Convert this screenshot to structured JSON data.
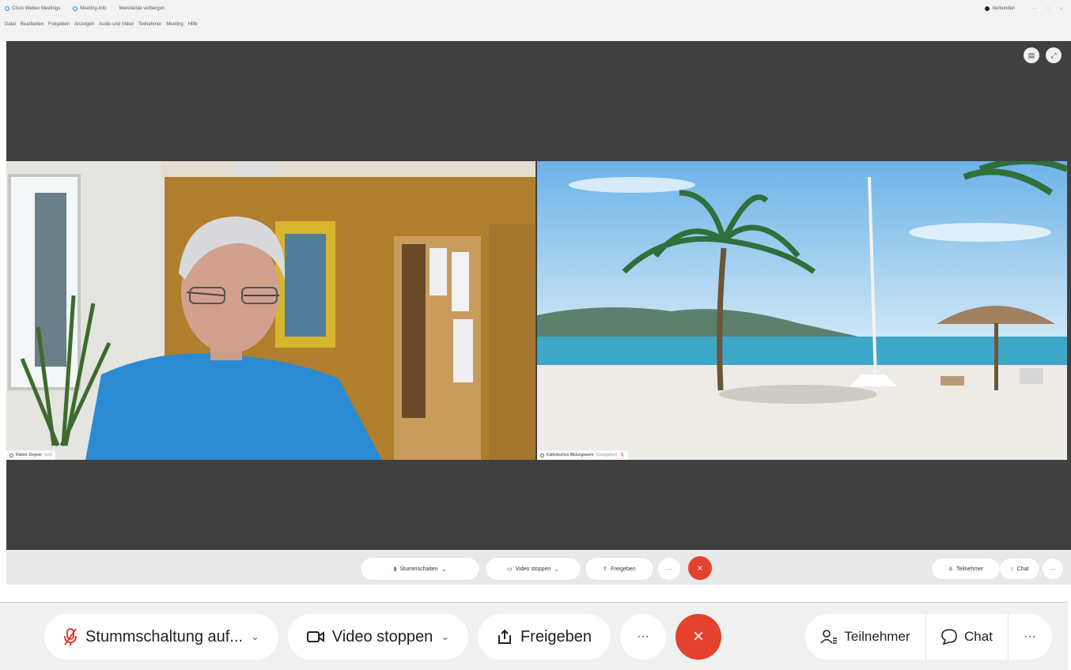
{
  "titlebar": {
    "app_name": "Cisco Webex Meetings",
    "meeting_info": "Meeting-Info",
    "hide_menu": "Menüleiste verbergen",
    "connected": "Verbunden"
  },
  "menu": [
    "Datei",
    "Bearbeiten",
    "Freigeben",
    "Anzeigen",
    "Audio und Video",
    "Teilnehmer",
    "Meeting",
    "Hilfe"
  ],
  "participants": [
    {
      "name": "Rainer Ziegner",
      "tag": "(ich)"
    },
    {
      "name": "Katholisches Bildungswerk",
      "tag": "(Gastgeber)"
    }
  ],
  "controls_small": {
    "mute": "Stummschalten",
    "video": "Video stoppen",
    "share": "Freigeben",
    "participants": "Teilnehmer",
    "chat": "Chat",
    "more": "···",
    "end": "×"
  },
  "controls_big": {
    "mute": "Stummschaltung auf...",
    "video": "Video stoppen",
    "share": "Freigeben",
    "more": "···",
    "end": "×",
    "participants": "Teilnehmer",
    "chat": "Chat",
    "more_right": "···"
  },
  "colors": {
    "end_red": "#e5412f",
    "stage_bg": "#404040",
    "mute_red": "#e5412f"
  }
}
